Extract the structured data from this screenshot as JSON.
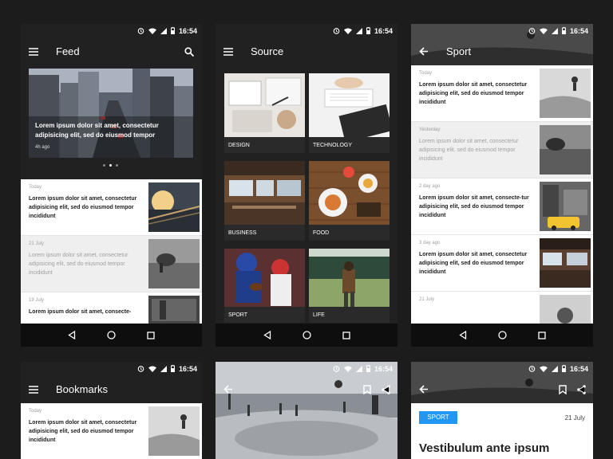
{
  "status": {
    "time": "16:54"
  },
  "feed": {
    "title": "Feed",
    "hero_caption": "Lorem ipsum dolor sit amet, consectetur adipisicing elit, sed do eiusmod tempor",
    "hero_time": "4h ago",
    "items": [
      {
        "date": "Today",
        "text": "Lorem ipsum dolor sit amet, consectetur adipisicing elit, sed do eiusmod tempor incididunt"
      },
      {
        "date": "21 July",
        "text": "Lorem ipsum dolor sit amet, consectetur adipisicing elit, sed do eiusmod tempor incididunt"
      },
      {
        "date": "19 July",
        "text": "Lorem ipsum dolor sit amet, consecte-"
      }
    ]
  },
  "source": {
    "title": "Source",
    "tiles": [
      {
        "label": "DESIGN"
      },
      {
        "label": "TECHNOLOGY"
      },
      {
        "label": "BUSINESS"
      },
      {
        "label": "FOOD"
      },
      {
        "label": "SPORT"
      },
      {
        "label": "LIFE"
      }
    ]
  },
  "sport": {
    "title": "Sport",
    "items": [
      {
        "date": "Today",
        "text": "Lorem ipsum dolor sit amet, consectetur adipisicing elit, sed do eiusmod tempor incididunt"
      },
      {
        "date": "Yesterday",
        "text": "Lorem ipsum dolor sit amet, consectetur adipisicing elit, sed do eiusmod tempor incididunt"
      },
      {
        "date": "2 day ago",
        "text": "Lorem ipsum dolor sit amet, consecte-tur adipisicing elit, sed do eiusmod tempor incididunt"
      },
      {
        "date": "3 day ago",
        "text": "Lorem ipsum dolor sit amet, consectetur adipisicing elit, sed do eiusmod tempor incididunt"
      },
      {
        "date": "21 July",
        "text": ""
      }
    ]
  },
  "bookmarks": {
    "title": "Bookmarks",
    "items": [
      {
        "date": "Today",
        "text": "Lorem ipsum dolor sit amet, consectetur adipisicing elit, sed do eiusmod tempor incididunt"
      }
    ]
  },
  "article": {
    "tag": "SPORT",
    "date": "21 July",
    "title": "Vestibulum ante ipsum"
  },
  "colors": {
    "accent": "#2196f3",
    "toolbar": "#212121",
    "nav": "#0e0e0e"
  }
}
